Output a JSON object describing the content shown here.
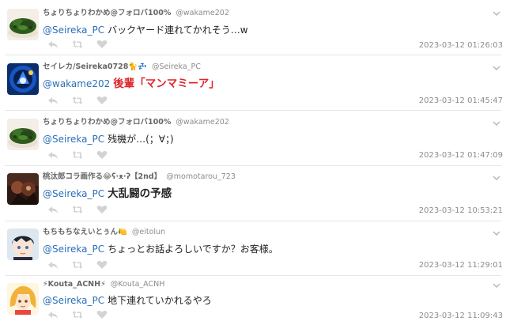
{
  "tweets": [
    {
      "display_name": "ちょりちょりわかめ@フォロバ100%",
      "handle": "@wakame202",
      "mention": "@Seireka_PC",
      "body": "バックヤード連れてかれそう…w",
      "timestamp": "2023-03-12 01:26:03",
      "avatar": "seaweed"
    },
    {
      "display_name": "セイレカ/Seireka0728🐈💤",
      "handle": "@Seireka_PC",
      "mention": "@wakame202",
      "body": "後輩「マンマミーア」",
      "timestamp": "2023-03-12 01:45:47",
      "avatar": "blue-emblem"
    },
    {
      "display_name": "ちょりちょりわかめ@フォロバ100%",
      "handle": "@wakame202",
      "mention": "@Seireka_PC",
      "body": "残機が…(；∀；)",
      "timestamp": "2023-03-12 01:47:09",
      "avatar": "seaweed"
    },
    {
      "display_name": "桃汰郎コラ画作る😂ʕ·ᴥ·ʔ【2nd】",
      "handle": "@momotarou_723",
      "mention": "@Seireka_PC",
      "body": "大乱闘の予感",
      "timestamp": "2023-03-12 10:53:21",
      "avatar": "dark-art"
    },
    {
      "display_name": "もちもちなえいとぅん🍋",
      "handle": "@eitolun",
      "mention": "@Seireka_PC",
      "body": "ちょっとお話よろしいですか？お客様。",
      "timestamp": "2023-03-12 11:29:01",
      "avatar": "anime-boy"
    },
    {
      "display_name": "⚡Kouta_ACNH⚡",
      "handle": "@Kouta_ACNH",
      "mention": "@Seireka_PC",
      "body": "地下連れていかれるやろ",
      "timestamp": "2023-03-12 11:09:43",
      "avatar": "blonde-girl"
    }
  ],
  "icons": {
    "reply": "reply-icon",
    "retweet": "retweet-icon",
    "like": "heart-icon",
    "menu": "chevron-down-icon"
  },
  "colors": {
    "mention": "#2a6fb8",
    "emphasis_red": "#e0262b",
    "muted": "#8c8c8c",
    "action_icon": "#d3d3d3"
  }
}
